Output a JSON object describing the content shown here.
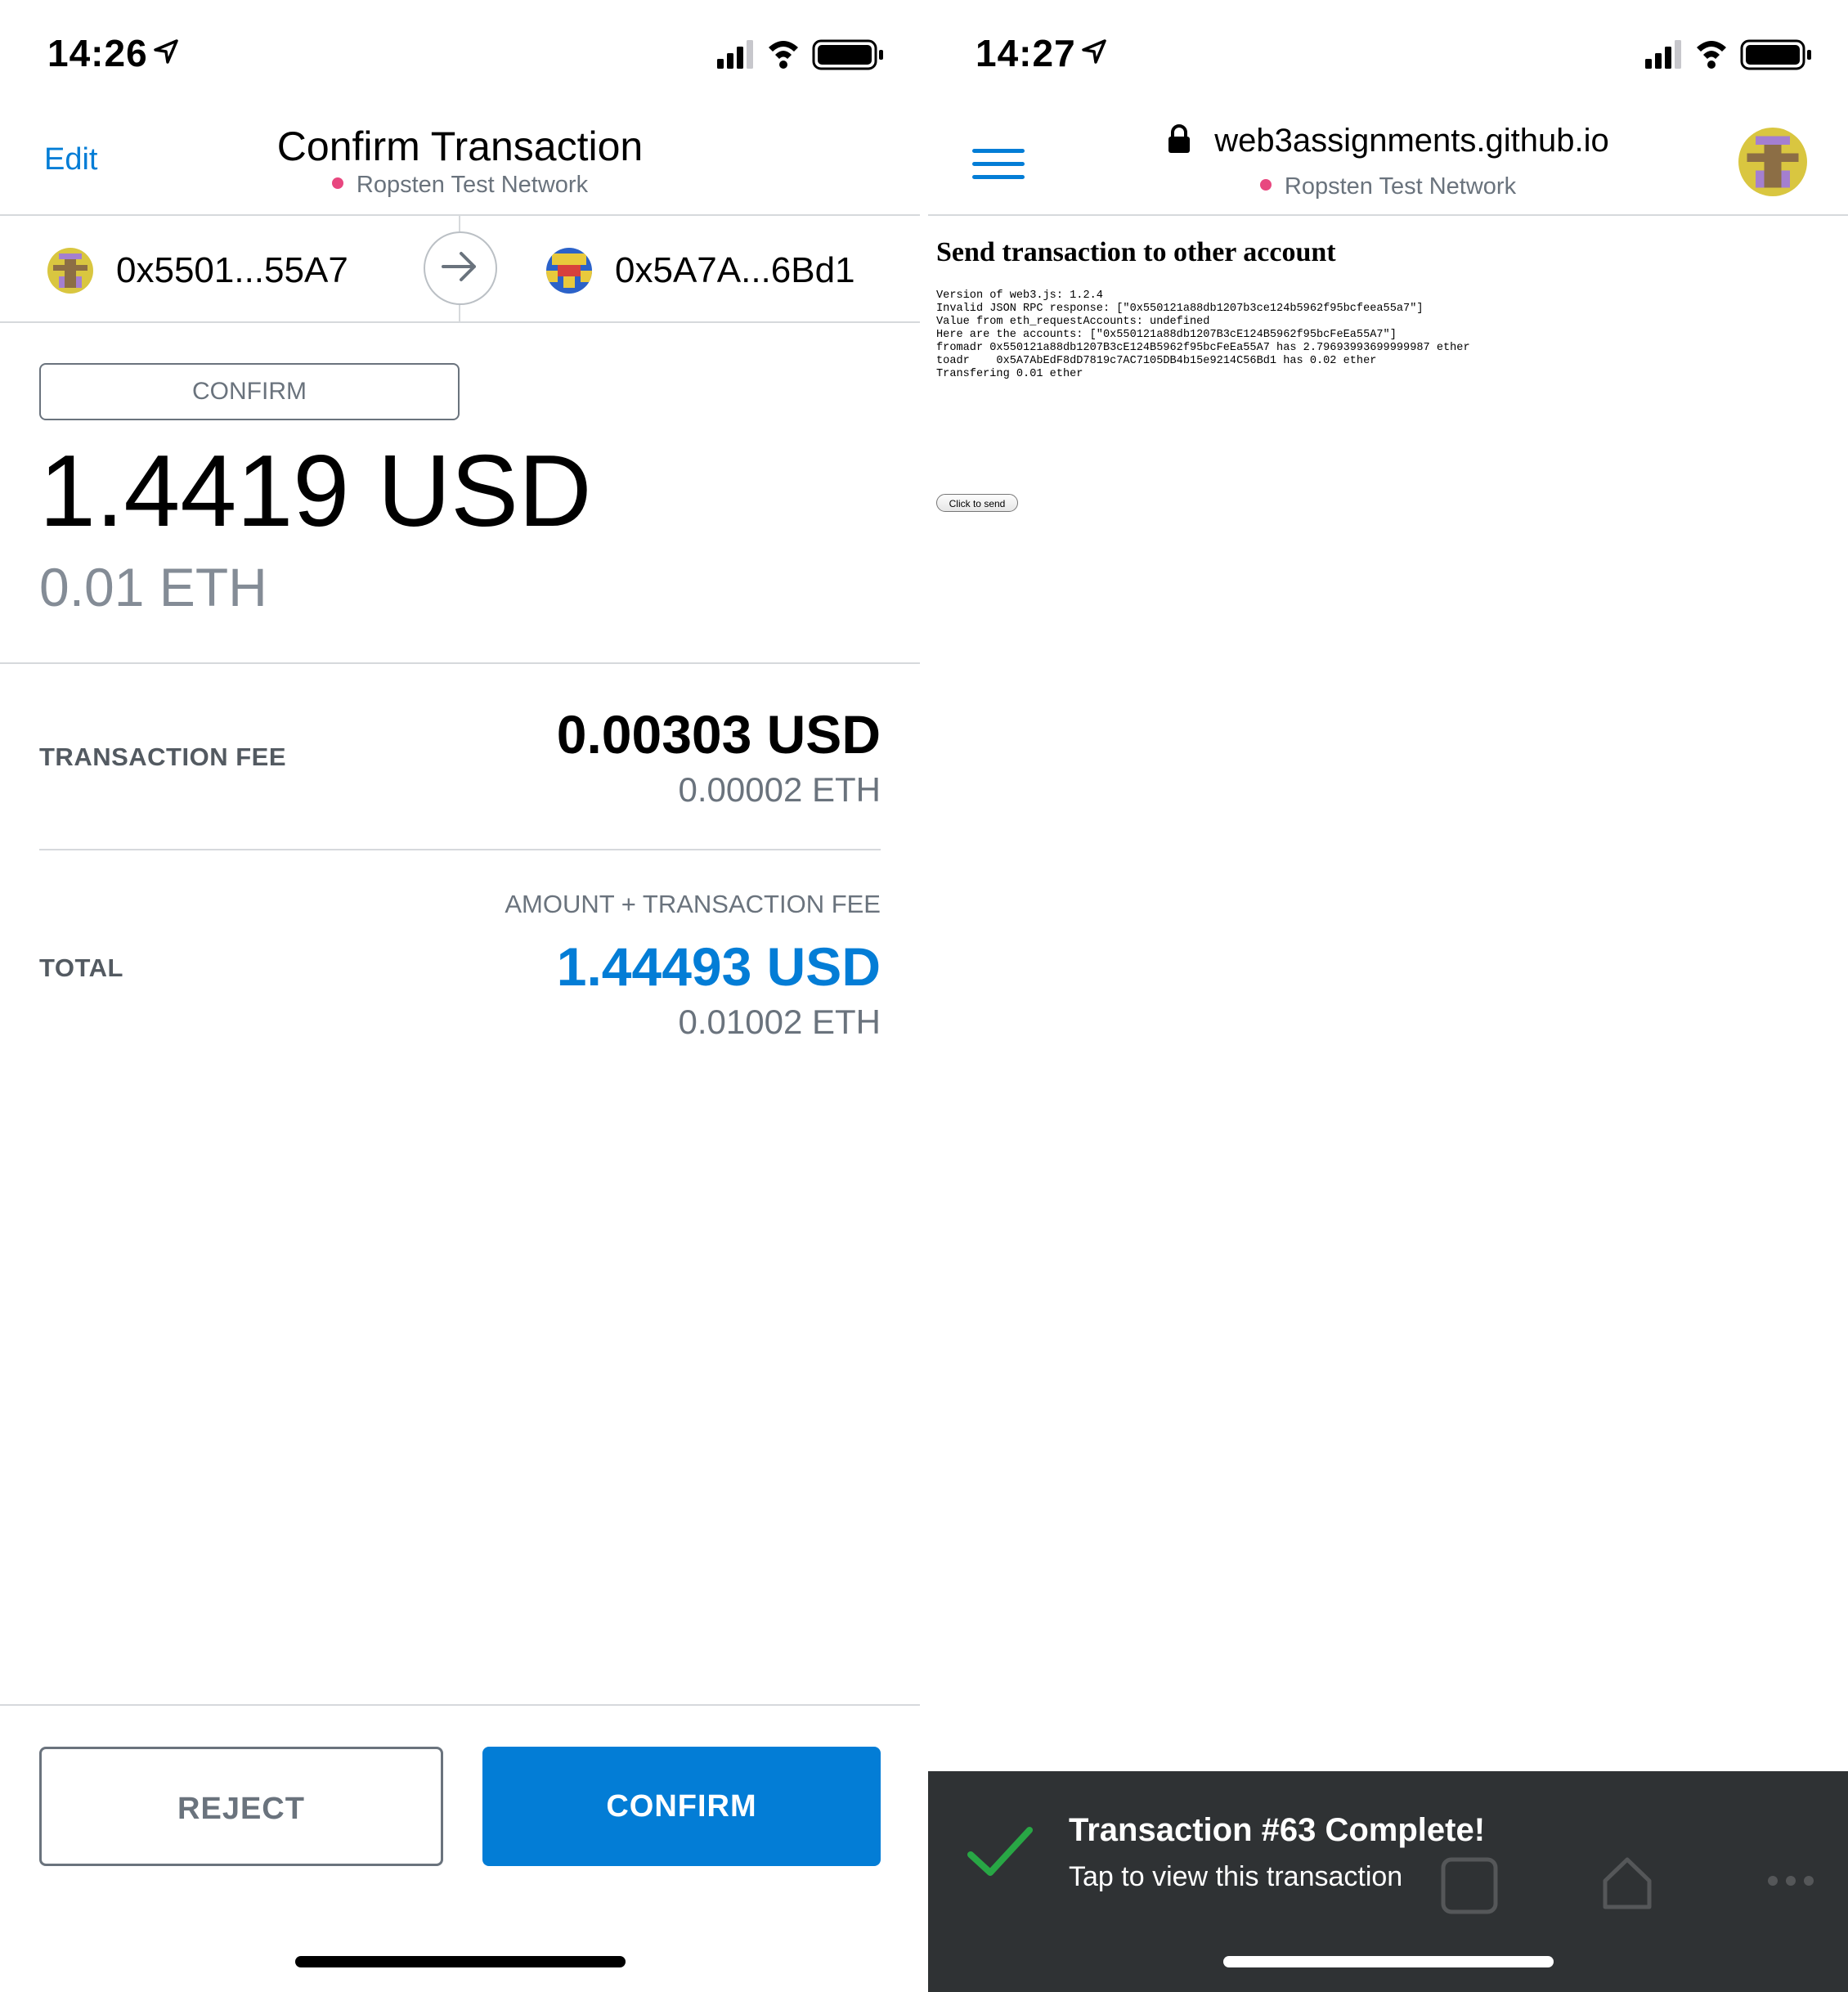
{
  "left": {
    "status": {
      "time": "14:26"
    },
    "header": {
      "edit_label": "Edit",
      "title": "Confirm Transaction",
      "network": "Ropsten Test Network"
    },
    "accounts": {
      "from": "0x5501...55A7",
      "to": "0x5A7A...6Bd1"
    },
    "amount": {
      "pill_label": "CONFIRM",
      "usd": "1.4419 USD",
      "eth": "0.01 ETH"
    },
    "fee": {
      "label": "TRANSACTION FEE",
      "usd": "0.00303 USD",
      "eth": "0.00002 ETH"
    },
    "total": {
      "caption": "AMOUNT + TRANSACTION FEE",
      "label": "TOTAL",
      "usd": "1.44493 USD",
      "eth": "0.01002 ETH"
    },
    "buttons": {
      "reject": "REJECT",
      "confirm": "CONFIRM"
    }
  },
  "right": {
    "status": {
      "time": "14:27"
    },
    "header": {
      "url": "web3assignments.github.io",
      "network": "Ropsten Test Network"
    },
    "page": {
      "heading": "Send transaction to other account",
      "log": [
        "Version of web3.js: 1.2.4",
        "Invalid JSON RPC response: [\"0x550121a88db1207b3ce124b5962f95bcfeea55a7\"]",
        "Value from eth_requestAccounts: undefined",
        "Here are the accounts: [\"0x550121a88db1207B3cE124B5962f95bcFeEa55A7\"]",
        "fromadr 0x550121a88db1207B3cE124B5962f95bcFeEa55A7 has 2.79693993699999987 ether",
        "toadr    0x5A7AbEdF8dD7819c7AC7105DB4b15e9214C56Bd1 has 0.02 ether",
        "Transfering 0.01 ether"
      ],
      "button_label": "Click to send"
    },
    "toast": {
      "title": "Transaction #63 Complete!",
      "subtitle": "Tap to view this transaction"
    }
  },
  "colors": {
    "accent": "#037dd6",
    "network_dot": "#e8477f",
    "muted": "#6a737d",
    "toast_bg": "#2f3234",
    "success": "#28a745"
  },
  "icons": [
    "location-arrow-icon",
    "signal-icon",
    "wifi-icon",
    "battery-icon",
    "arrow-right-icon",
    "lock-icon",
    "hamburger-menu-icon",
    "check-icon",
    "identicon"
  ]
}
